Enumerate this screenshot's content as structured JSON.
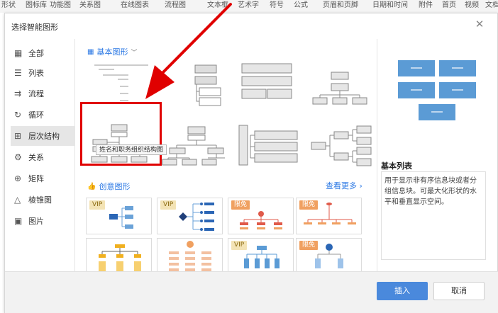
{
  "ribbon": {
    "items": [
      "形状",
      "图标库",
      "功能图",
      "关系图",
      "在线图表",
      "流程图",
      "文本框",
      "艺术字",
      "符号",
      "公式",
      "页眉和页脚",
      "日期和时间",
      "附件",
      "首页",
      "视频",
      "文档"
    ]
  },
  "dialog": {
    "title": "选择智能图形",
    "close_glyph": "✕"
  },
  "sidebar": {
    "items": [
      {
        "label": "全部",
        "icon": "grid-icon",
        "glyph": "▦"
      },
      {
        "label": "列表",
        "icon": "list-icon",
        "glyph": "☰"
      },
      {
        "label": "流程",
        "icon": "process-icon",
        "glyph": "⇉"
      },
      {
        "label": "循环",
        "icon": "cycle-icon",
        "glyph": "↻"
      },
      {
        "label": "层次结构",
        "icon": "hierarchy-icon",
        "glyph": "⊞"
      },
      {
        "label": "关系",
        "icon": "relation-icon",
        "glyph": "⚙"
      },
      {
        "label": "矩阵",
        "icon": "matrix-icon",
        "glyph": "⊕"
      },
      {
        "label": "棱锥图",
        "icon": "pyramid-icon",
        "glyph": "△"
      },
      {
        "label": "图片",
        "icon": "picture-icon",
        "glyph": "▣"
      }
    ],
    "active_index": 4
  },
  "basic": {
    "title": "基本图形",
    "chevron": "﹀"
  },
  "creative": {
    "title": "创意图形",
    "more": "查看更多 ›"
  },
  "tooltip": "姓名和职务组织结构图",
  "cards": [
    {
      "badge": "VIP",
      "type": "vip"
    },
    {
      "badge": "VIP",
      "type": "vip"
    },
    {
      "badge": "限免",
      "type": "xm"
    },
    {
      "badge": "限免",
      "type": "xm"
    },
    {
      "badge": "",
      "type": "none"
    },
    {
      "badge": "",
      "type": "none"
    },
    {
      "badge": "VIP",
      "type": "vip"
    },
    {
      "badge": "限免",
      "type": "xm"
    }
  ],
  "preview": {
    "title": "基本列表",
    "description": "用于显示非有序信息块或者分组信息块。可最大化形状的水平和垂直显示空间。",
    "accent": "#5b9bd5"
  },
  "footer": {
    "insert": "插入",
    "cancel": "取消"
  },
  "colors": {
    "accent": "#4a89dc",
    "highlight": "#e00000"
  }
}
